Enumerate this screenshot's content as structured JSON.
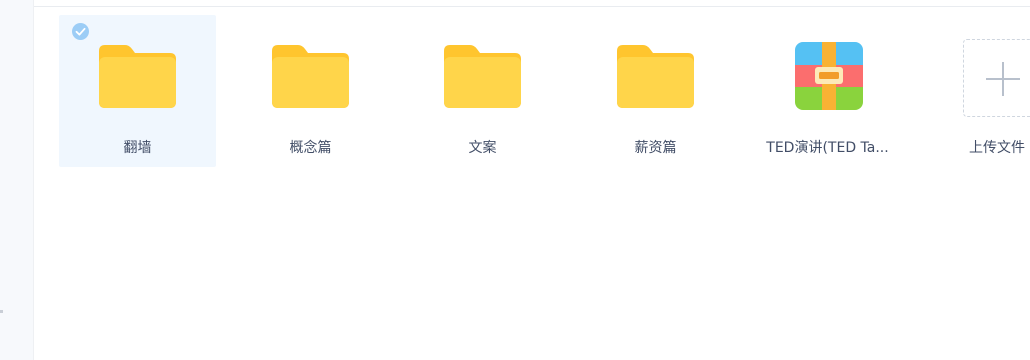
{
  "files": [
    {
      "name": "翻墙",
      "type": "folder",
      "selected": true
    },
    {
      "name": "概念篇",
      "type": "folder",
      "selected": false
    },
    {
      "name": "文案",
      "type": "folder",
      "selected": false
    },
    {
      "name": "薪资篇",
      "type": "folder",
      "selected": false
    },
    {
      "name": "TED演讲(TED Ta...",
      "type": "archive",
      "selected": false
    }
  ],
  "upload": {
    "label": "上传文件"
  },
  "icons": {
    "folder": "folder-icon",
    "archive": "archive-icon",
    "check": "check-icon",
    "plus": "plus-icon"
  },
  "colors": {
    "folder": "#ffd54a",
    "folder_tab": "#ffc52e",
    "selected_bg": "#f0f7fe",
    "check": "#9ccdf6",
    "text": "#424e67"
  }
}
